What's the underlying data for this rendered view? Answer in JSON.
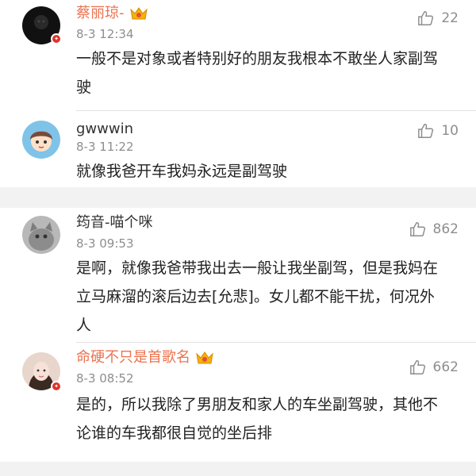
{
  "comments": [
    {
      "user": "蔡丽琼-",
      "time": "8-3 12:34",
      "likes": "22",
      "text": "一般不是对象或者特别好的朋友我根本不敢坐人家副驾驶",
      "vip": true,
      "verified": true
    },
    {
      "user": "gwwwin",
      "time": "8-3 11:22",
      "likes": "10",
      "text": "就像我爸开车我妈永远是副驾驶",
      "vip": false,
      "verified": false
    },
    {
      "user": "筠音-喵个咪",
      "time": "8-3 09:53",
      "likes": "862",
      "text": "是啊，就像我爸带我出去一般让我坐副驾，但是我妈在立马麻溜的滚后边去[允悲]。女儿都不能干扰，何况外人",
      "vip": false,
      "verified": false
    },
    {
      "user": "命硬不只是首歌名",
      "time": "8-3 08:52",
      "likes": "662",
      "text": "是的，所以我除了男朋友和家人的车坐副驾驶，其他不论谁的车我都很自觉的坐后排",
      "vip": true,
      "verified": true
    }
  ],
  "colors": {
    "vip_name": "#eb7350",
    "name": "#333333",
    "meta": "#8e8e8e",
    "gap": "#f2f2f2",
    "verified_badge": "#e0322a"
  },
  "icons": {
    "like": "thumbs-up-icon",
    "vip": "crown-vip-icon",
    "verified": "verified-badge-icon"
  }
}
